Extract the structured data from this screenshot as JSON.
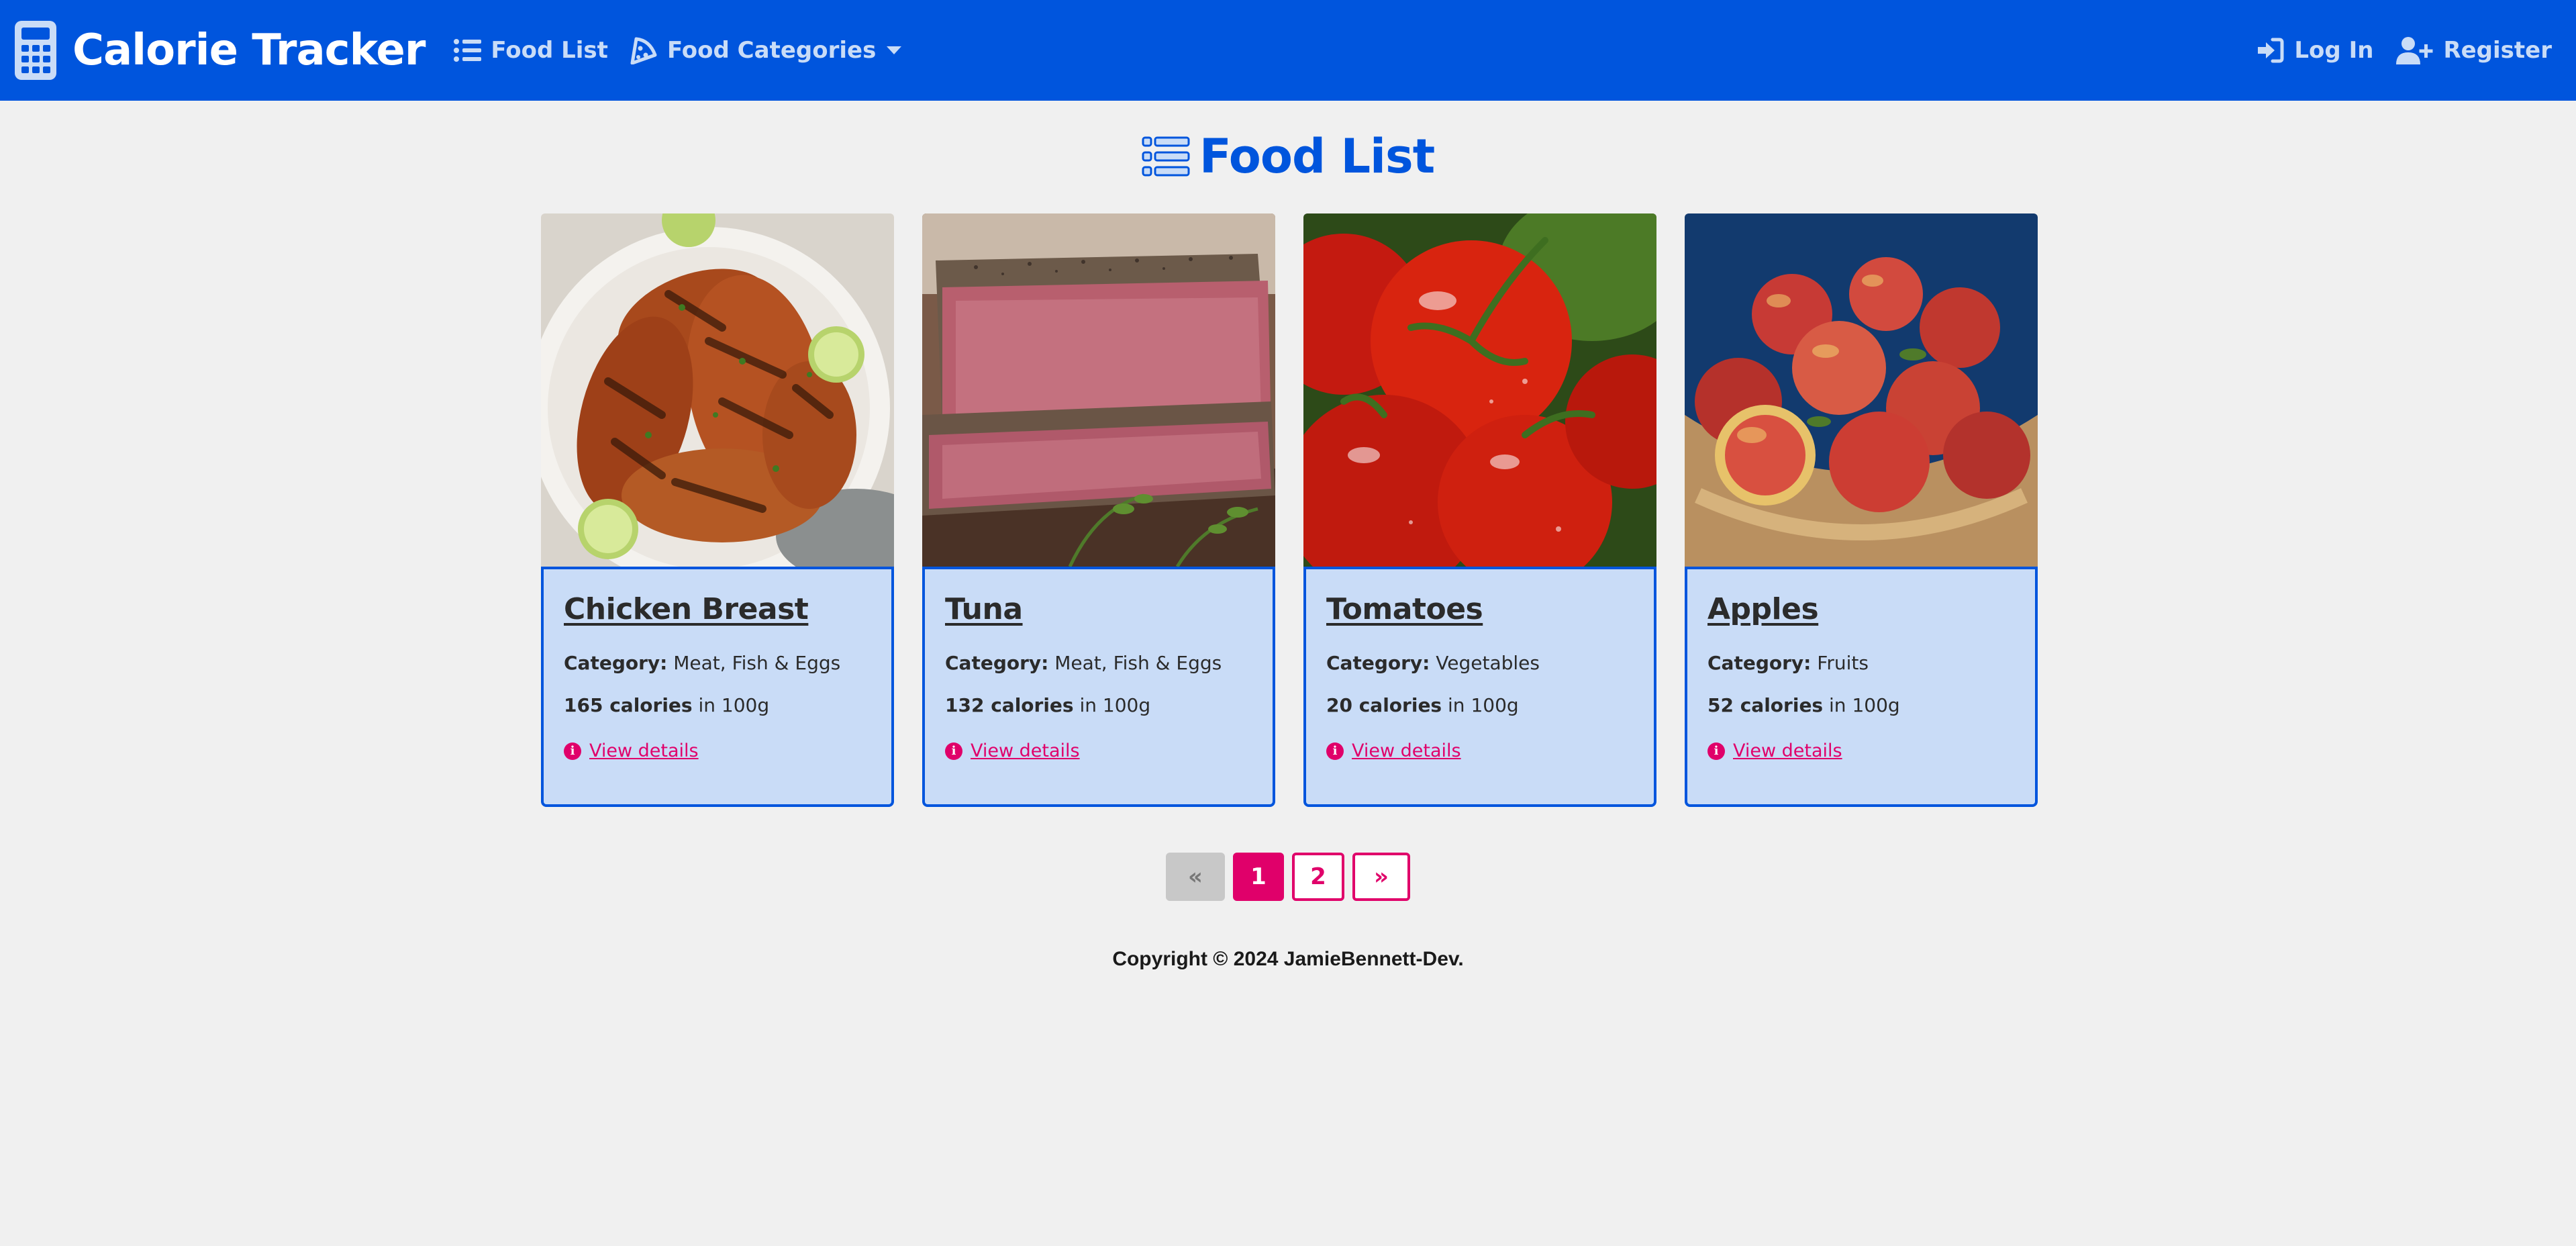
{
  "navbar": {
    "brand": "Calorie Tracker",
    "food_list": "Food List",
    "food_categories": "Food Categories",
    "log_in": "Log In",
    "register": "Register"
  },
  "page": {
    "heading": "Food List"
  },
  "foods": [
    {
      "name": "Chicken Breast",
      "category_label": "Category:",
      "category": "Meat, Fish & Eggs",
      "calories": "165 calories",
      "serving": "in 100g",
      "link": "View details"
    },
    {
      "name": "Tuna",
      "category_label": "Category:",
      "category": "Meat, Fish & Eggs",
      "calories": "132 calories",
      "serving": "in 100g",
      "link": "View details"
    },
    {
      "name": "Tomatoes",
      "category_label": "Category:",
      "category": "Vegetables",
      "calories": "20 calories",
      "serving": "in 100g",
      "link": "View details"
    },
    {
      "name": "Apples",
      "category_label": "Category:",
      "category": "Fruits",
      "calories": "52 calories",
      "serving": "in 100g",
      "link": "View details"
    }
  ],
  "pagination": {
    "prev": "«",
    "pages": [
      "1",
      "2"
    ],
    "current": "1",
    "next": "»"
  },
  "footer": {
    "copyright": "Copyright © 2024 JamieBennett-Dev."
  },
  "colors": {
    "primary": "#0055dd",
    "accent": "#e0006a",
    "card_bg": "#c9dcf7",
    "page_bg": "#f0f0f0"
  }
}
